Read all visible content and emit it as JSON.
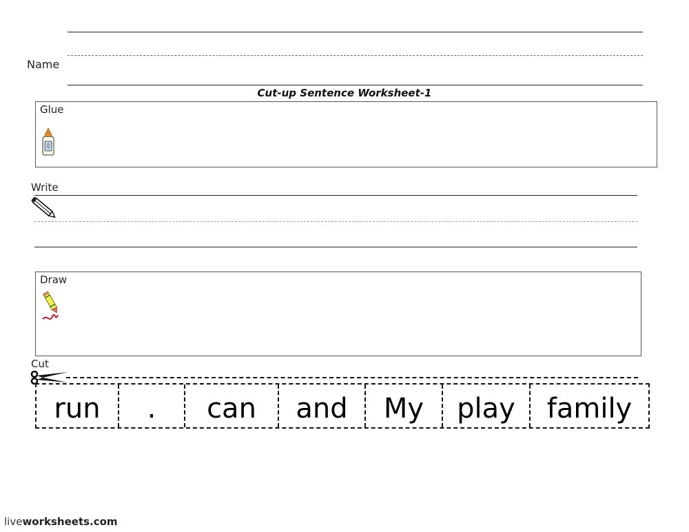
{
  "header": {
    "name_label": "Name",
    "title": "Cut-up Sentence Worksheet-1"
  },
  "sections": {
    "glue": {
      "label": "Glue",
      "icon": "glue-bottle-icon"
    },
    "write": {
      "label": "Write",
      "icon": "pencil-icon"
    },
    "draw": {
      "label": "Draw",
      "icon": "crayon-icon"
    },
    "cut": {
      "label": "Cut",
      "icon": "scissors-icon"
    }
  },
  "word_tiles": [
    {
      "word": "run"
    },
    {
      "word": "."
    },
    {
      "word": "can"
    },
    {
      "word": "and"
    },
    {
      "word": "My"
    },
    {
      "word": "play"
    },
    {
      "word": "family"
    }
  ],
  "footer": {
    "brand_light": "live",
    "brand_bold": "worksheets.com"
  }
}
